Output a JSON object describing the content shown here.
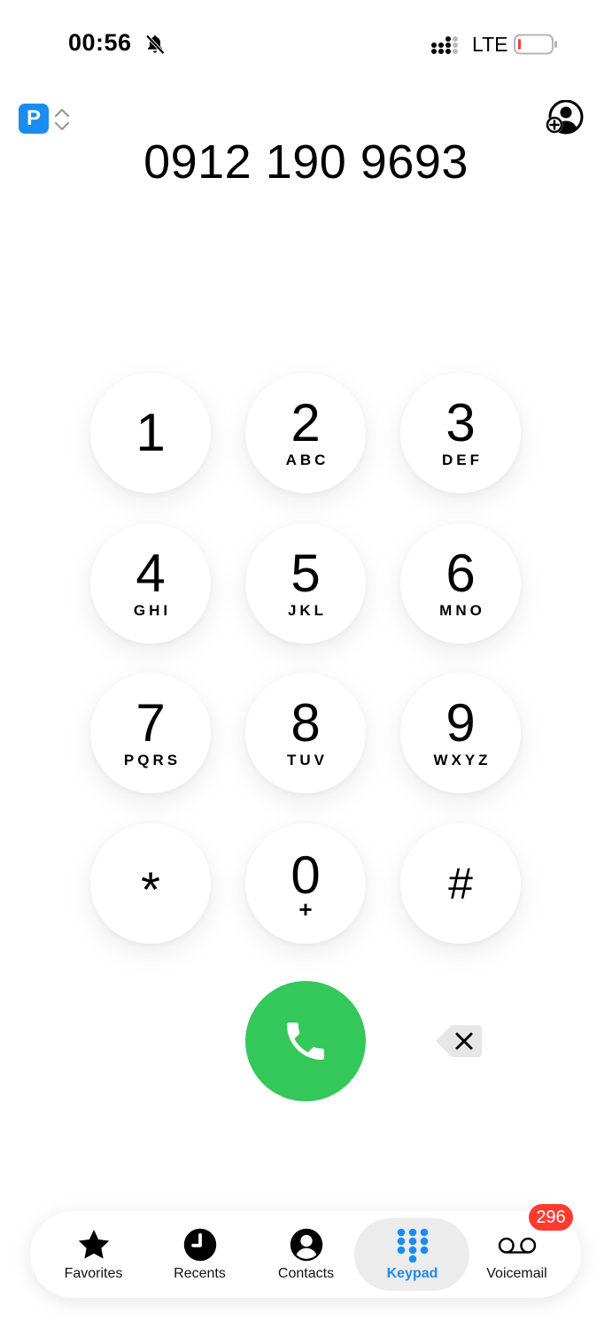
{
  "status_bar": {
    "time": "00:56",
    "network": "LTE",
    "icons": [
      "bell-slash-icon",
      "signal-icon",
      "battery-icon"
    ]
  },
  "header": {
    "sim_label": "P",
    "sim_color": "#1a8cf0"
  },
  "dialed_number": "0912 190 9693",
  "keypad": [
    {
      "digit": "1",
      "letters": ""
    },
    {
      "digit": "2",
      "letters": "ABC"
    },
    {
      "digit": "3",
      "letters": "DEF"
    },
    {
      "digit": "4",
      "letters": "GHI"
    },
    {
      "digit": "5",
      "letters": "JKL"
    },
    {
      "digit": "6",
      "letters": "MNO"
    },
    {
      "digit": "7",
      "letters": "PQRS"
    },
    {
      "digit": "8",
      "letters": "TUV"
    },
    {
      "digit": "9",
      "letters": "WXYZ"
    },
    {
      "digit": "*",
      "letters": ""
    },
    {
      "digit": "0",
      "letters": "+"
    },
    {
      "digit": "#",
      "letters": ""
    }
  ],
  "call_color": "#34c759",
  "tabs": [
    {
      "label": "Favorites",
      "icon": "star-icon"
    },
    {
      "label": "Recents",
      "icon": "clock-icon"
    },
    {
      "label": "Contacts",
      "icon": "person-circle-icon"
    },
    {
      "label": "Keypad",
      "icon": "keypad-grid-icon",
      "active": true
    },
    {
      "label": "Voicemail",
      "icon": "voicemail-icon",
      "badge": "296"
    }
  ],
  "accent_color": "#1a8cf0",
  "badge_color": "#ff3b30"
}
